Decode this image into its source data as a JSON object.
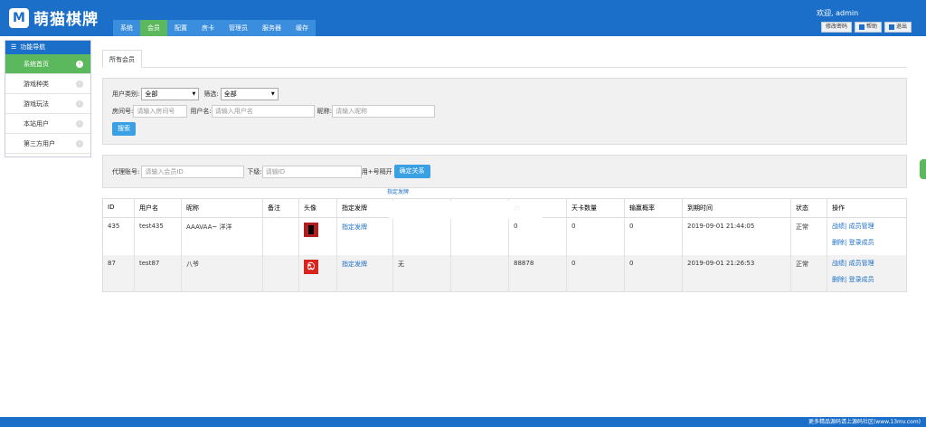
{
  "header": {
    "logo_letter": "M",
    "logo_text": "萌猫棋牌",
    "nav": [
      "系统",
      "会员",
      "配置",
      "房卡",
      "管理员",
      "服务器",
      "缓存"
    ],
    "active_nav": 1,
    "welcome": "欢迎, admin",
    "buttons": {
      "change_pwd": "修改密码",
      "help": "帮助",
      "logout": "退出"
    }
  },
  "sidebar": {
    "title": "功能导航",
    "items": [
      "系统首页",
      "游戏种类",
      "游戏玩法",
      "本站用户",
      "第三方用户"
    ]
  },
  "tab": "所有会员",
  "filter": {
    "user_type_label": "用户类别:",
    "user_type_value": "全部",
    "filter_label": "筛选:",
    "filter_value": "全部",
    "room_label": "房间号:",
    "room_ph": "请输入房间号",
    "user_label": "用户名:",
    "user_ph": "请输入用户名",
    "nick_label": "昵称:",
    "nick_ph": "请输入昵称",
    "search": "搜索"
  },
  "agent": {
    "label": "代理账号:",
    "agent_ph": "请输入会员ID",
    "sub_label": "下级:",
    "sub_ph": "请输ID",
    "hint": "用+号隔开",
    "bind": "确定关系",
    "tip": "指定发牌"
  },
  "table": {
    "headers": [
      "ID",
      "用户名",
      "昵称",
      "备注",
      "头像",
      "指定发牌",
      "",
      "",
      "カ",
      "天卡数量",
      "输赢概率",
      "到期时间",
      "状态",
      "操作"
    ],
    "rows": [
      {
        "id": "435",
        "user": "test435",
        "nick": "AAAVAA~ 洋洋",
        "note": "",
        "deal": "指定发牌",
        "c6": "",
        "c7": "",
        "c8": "0",
        "days": "0",
        "rate": "0",
        "expire": "2019-09-01 21:44:05",
        "status": "正常",
        "op1": "战绩| 成员管理",
        "op2": "删除| 登录成员"
      },
      {
        "id": "87",
        "user": "test87",
        "nick": "八爷",
        "note": "",
        "deal": "指定发牌",
        "c6": "无",
        "c7": "",
        "c8": "88878",
        "days": "0",
        "rate": "0",
        "expire": "2019-09-01 21:26:53",
        "status": "正常",
        "op1": "战绩| 成员管理",
        "op2": "删除| 登录成员"
      }
    ]
  },
  "footer": "更多精品源码请上源码社区(www.13mv.com)"
}
